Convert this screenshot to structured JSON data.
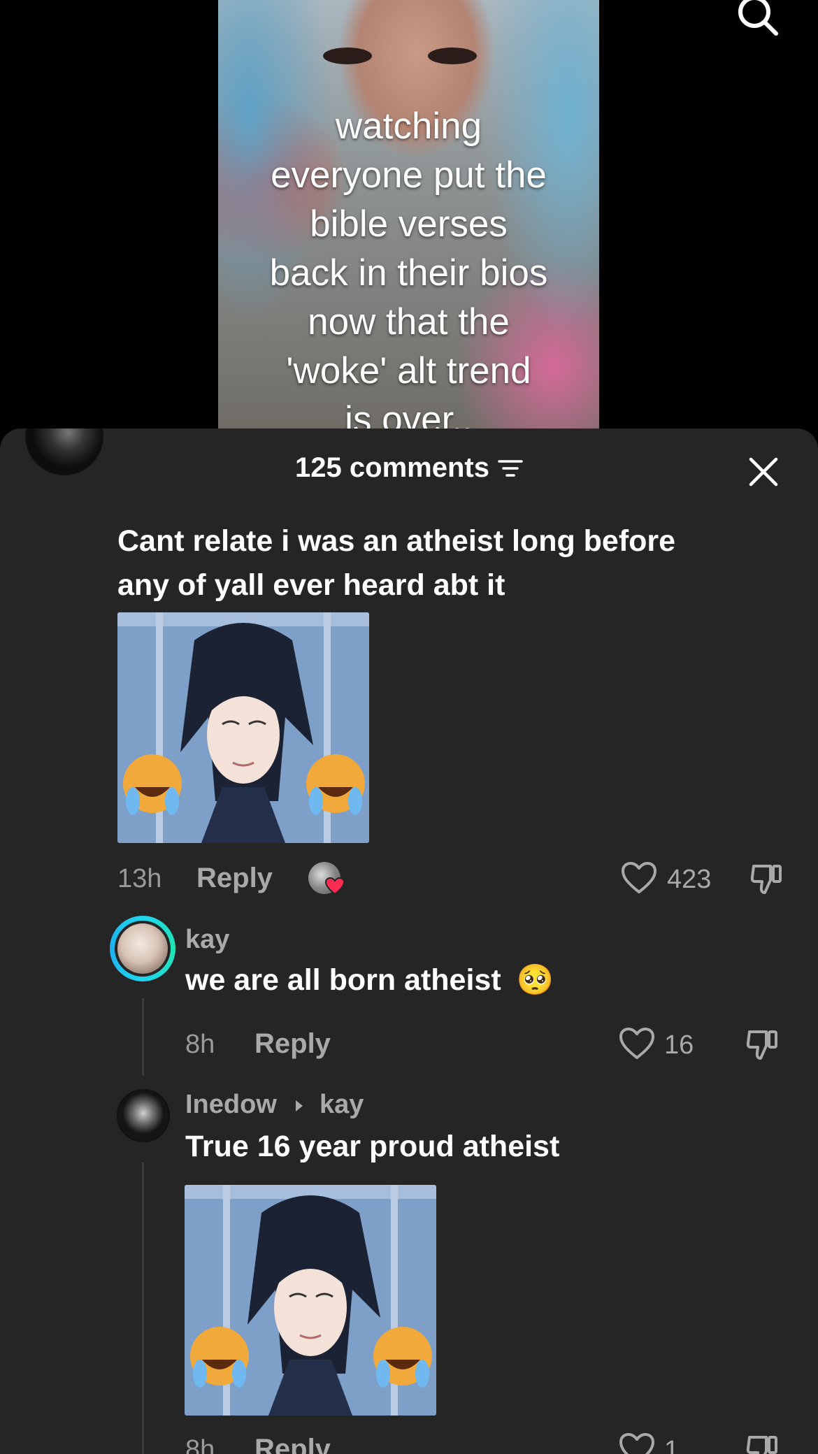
{
  "video": {
    "caption": "watching\neveryone put the\nbible verses\nback in their bios\nnow that the\n'woke' alt trend\nis over.."
  },
  "header": {
    "comment_count": "125 comments"
  },
  "comments": [
    {
      "text_line1": "Cant relate i was an atheist long before",
      "text_line2": "any of yall ever heard abt it",
      "time": "13h",
      "reply_label": "Reply",
      "likes": "423"
    }
  ],
  "replies": [
    {
      "username": "kay",
      "text": "we are all born atheist",
      "emoji": "🥺",
      "time": "8h",
      "reply_label": "Reply",
      "likes": "16"
    },
    {
      "username": "Inedow",
      "reply_to": "kay",
      "text": "True 16 year proud atheist",
      "time": "8h",
      "reply_label": "Reply",
      "likes": "1"
    }
  ],
  "colors": {
    "sheet_bg": "#252525",
    "accent_heart": "#fe2c55",
    "story_ring": "#20d5ec"
  }
}
